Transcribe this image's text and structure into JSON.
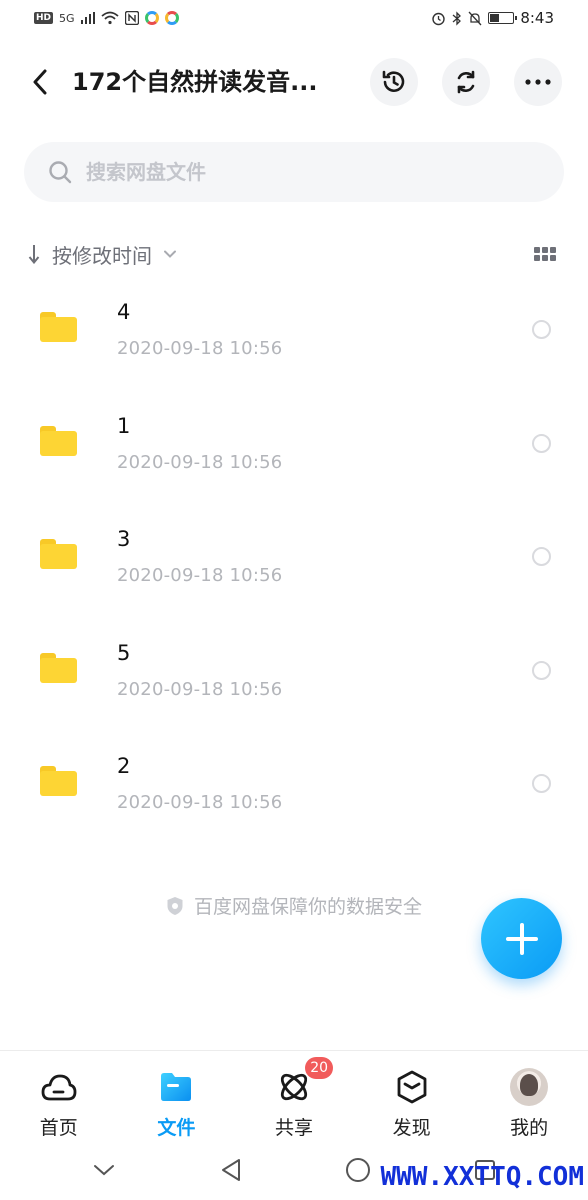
{
  "status_bar": {
    "badge_hd": "HD",
    "signal_text": "5G",
    "time": "8:43",
    "battery_level": 0.35
  },
  "header": {
    "title": "172个自然拼读发音...",
    "back_icon": "chevron-left-icon",
    "history_icon": "history-icon",
    "sync_icon": "sync-icon",
    "more_icon": "more-icon"
  },
  "search": {
    "placeholder": "搜索网盘文件"
  },
  "sort": {
    "label": "按修改时间"
  },
  "files": [
    {
      "name": "4",
      "date": "2020-09-18  10:56"
    },
    {
      "name": "1",
      "date": "2020-09-18  10:56"
    },
    {
      "name": "3",
      "date": "2020-09-18  10:56"
    },
    {
      "name": "5",
      "date": "2020-09-18  10:56"
    },
    {
      "name": "2",
      "date": "2020-09-18  10:56"
    }
  ],
  "safety_note": "百度网盘保障你的数据安全",
  "bottom_nav": {
    "home": "首页",
    "files": "文件",
    "share": "共享",
    "share_badge": "20",
    "discover": "发现",
    "me": "我的"
  },
  "watermark": "WWW.XXTTQ.COM",
  "colors": {
    "accent": "#0a9bf5",
    "folder": "#fdd534",
    "badge": "#f15b5b"
  }
}
